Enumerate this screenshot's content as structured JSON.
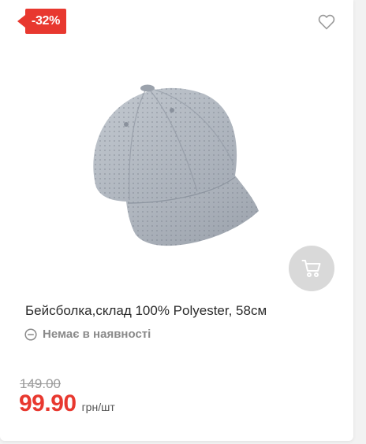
{
  "product": {
    "discount_badge": "-32%",
    "title": "Бейсболка,склад 100% Polyester, 58см",
    "stock_status": "Немає в наявності",
    "old_price": "149.00",
    "price": "99.90",
    "price_unit": "грн/шт",
    "image_subject": "grey perforated baseball cap"
  },
  "icons": {
    "wishlist": "heart-outline-icon",
    "cart": "cart-icon",
    "stock": "minus-circle-icon"
  },
  "colors": {
    "accent": "#e8382f",
    "cap": "#a9b0b9",
    "cart_button": "#d9d9d9"
  }
}
